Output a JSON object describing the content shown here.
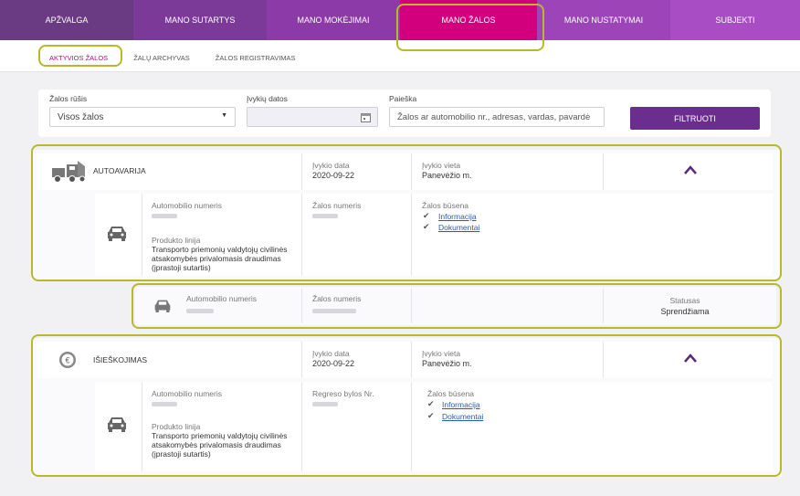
{
  "nav": {
    "tabs": [
      {
        "label": "APŽVALGA",
        "color": "#6a3a82"
      },
      {
        "label": "MANO SUTARTYS",
        "color": "#7b3a98"
      },
      {
        "label": "MANO MOKĖJIMAI",
        "color": "#8c3aa8"
      },
      {
        "label": "MANO ŽALOS",
        "color": "#d2007d"
      },
      {
        "label": "MANO NUSTATYMAI",
        "color": "#9c44b8"
      },
      {
        "label": "SUBJEKTI",
        "color": "#a84dc4"
      }
    ],
    "subtabs": [
      "AKTYVIOS ŽALOS",
      "ŽALŲ ARCHYVAS",
      "ŽALOS REGISTRAVIMAS"
    ]
  },
  "filter": {
    "type_label": "Žalos rūšis",
    "type_value": "Visos žalos",
    "dates_label": "Įvykių datos",
    "search_label": "Paieška",
    "search_placeholder": "Žalos ar automobilio nr., adresas, vardas, pavardė",
    "button": "FILTRUOTI"
  },
  "claims": [
    {
      "title": "AUTOAVARIJA",
      "date_label": "Įvykio data",
      "date": "2020-09-22",
      "place_label": "Įvykio vieta",
      "place": "Panevėžio m.",
      "detail": {
        "car_label": "Automobilio numeris",
        "product_label": "Produkto linija",
        "product": "Transporto priemonių valdytojų civilinės atsakomybės privalomasis draudimas (įprastoji sutartis)",
        "number_label": "Žalos numeris",
        "status_label": "Žalos būsena",
        "links": [
          "Informacija",
          "Dokumentai"
        ]
      },
      "subrow": {
        "car_label": "Automobilio numeris",
        "number_label": "Žalos numeris",
        "status_label": "Statusas",
        "status": "Sprendžiama"
      }
    },
    {
      "title": "IŠIEŠKOJIMAS",
      "date_label": "Įvykio data",
      "date": "2020-09-22",
      "place_label": "Įvykio vieta",
      "place": "Panevėžio m.",
      "detail": {
        "car_label": "Automobilio numeris",
        "product_label": "Produkto linija",
        "product": "Transporto priemonių valdytojų civilinės atsakomybės privalomasis draudimas (įprastoji sutartis)",
        "number_label": "Regreso bylos Nr.",
        "status_label": "Žalos būsena",
        "links": [
          "Informacija",
          "Dokumentai"
        ]
      }
    }
  ]
}
